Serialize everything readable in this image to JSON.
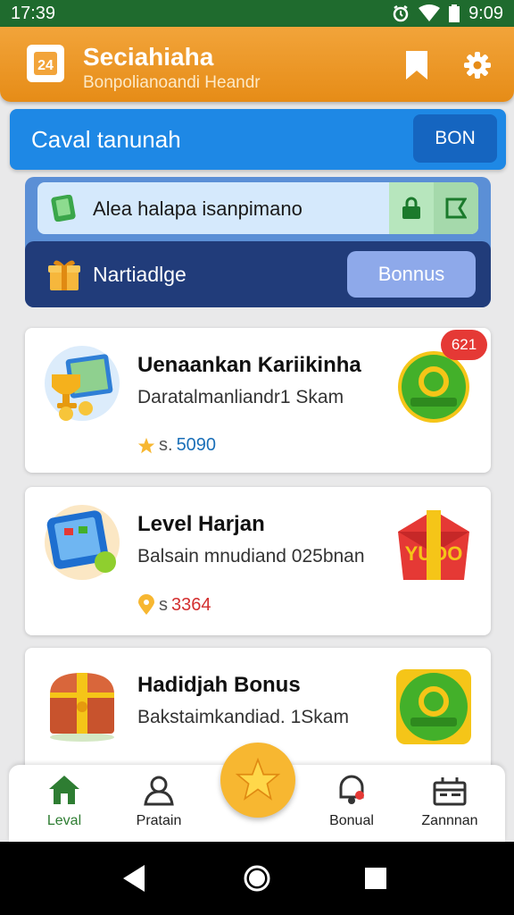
{
  "status_bar": {
    "time_left": "17:39",
    "time_right": "9:09",
    "icons": [
      "alarm-icon",
      "wifi-icon",
      "battery-icon"
    ]
  },
  "app_bar": {
    "title": "Seciahiaha",
    "subtitle": "Bonpolianoandi Heandr",
    "logo_text": "24",
    "icons": [
      "bookmark-icon",
      "settings-icon"
    ]
  },
  "banner": {
    "title": "Caval tanunah",
    "button_label": "BON"
  },
  "promo": {
    "top_text": "Alea halapa isanpimano",
    "bottom_text": "Nartiadlge",
    "bonus_button": "Bonnus"
  },
  "cards": [
    {
      "title": "Uenaankan Kariikinha",
      "description": "Daratalmanliandr1 Skam",
      "stat_prefix": "s.",
      "stat_value": "5090",
      "stat_color": "#1a6fb8",
      "badge": "621"
    },
    {
      "title": "Level Harjan",
      "description": "Balsain mnudiand 025bnan",
      "stat_prefix": "s",
      "stat_value": "3364",
      "stat_color": "#d32f2f",
      "side_text": "YUOO"
    },
    {
      "title": "Hadidjah Bonus",
      "description": "Bakstaimkandiad. 1Skam"
    }
  ],
  "bottom_nav": {
    "items": [
      {
        "label": "Leval",
        "icon": "home-icon",
        "active": true
      },
      {
        "label": "Pratain",
        "icon": "profile-icon",
        "active": false
      },
      {
        "label": "Bonual",
        "icon": "notification-icon",
        "active": false
      },
      {
        "label": "Zannnan",
        "icon": "gift-box-icon",
        "active": false
      }
    ],
    "fab_icon": "star-icon"
  },
  "colors": {
    "app_bar": "#e68c17",
    "banner": "#1e88e5",
    "promo_dark": "#213c7a",
    "active_green": "#2e7d32"
  }
}
